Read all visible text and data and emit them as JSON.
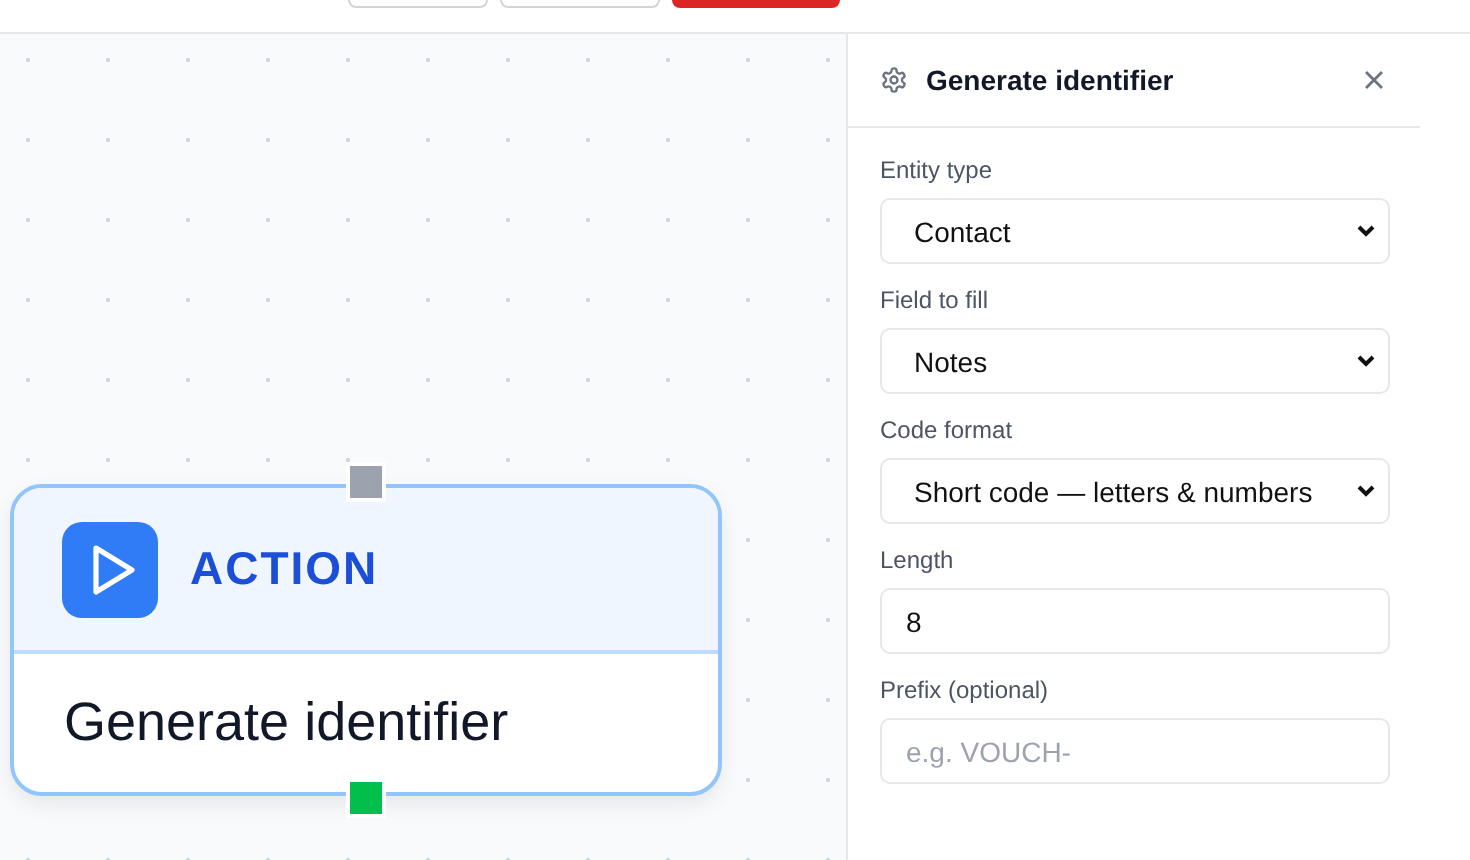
{
  "toolbar_buttons": [
    {
      "kind": "default"
    },
    {
      "kind": "default"
    },
    {
      "kind": "danger"
    }
  ],
  "canvas": {
    "node": {
      "kind": "action",
      "type_label": "ACTION",
      "title": "Generate identifier",
      "handles": [
        {
          "kind": "input",
          "color": "#9ca3af"
        },
        {
          "kind": "output",
          "color": "#00c04b"
        }
      ]
    }
  },
  "panel": {
    "title": "Generate identifier",
    "fields": [
      {
        "kind": "select",
        "label": "Entity type",
        "value": "Contact"
      },
      {
        "kind": "select",
        "label": "Field to fill",
        "value": "Notes"
      },
      {
        "kind": "select",
        "label": "Code format",
        "value": "Short code — letters & numbers"
      },
      {
        "kind": "input",
        "label": "Length",
        "value": "8"
      },
      {
        "kind": "input",
        "label": "Prefix (optional)",
        "placeholder": "e.g. VOUCH-"
      }
    ]
  }
}
